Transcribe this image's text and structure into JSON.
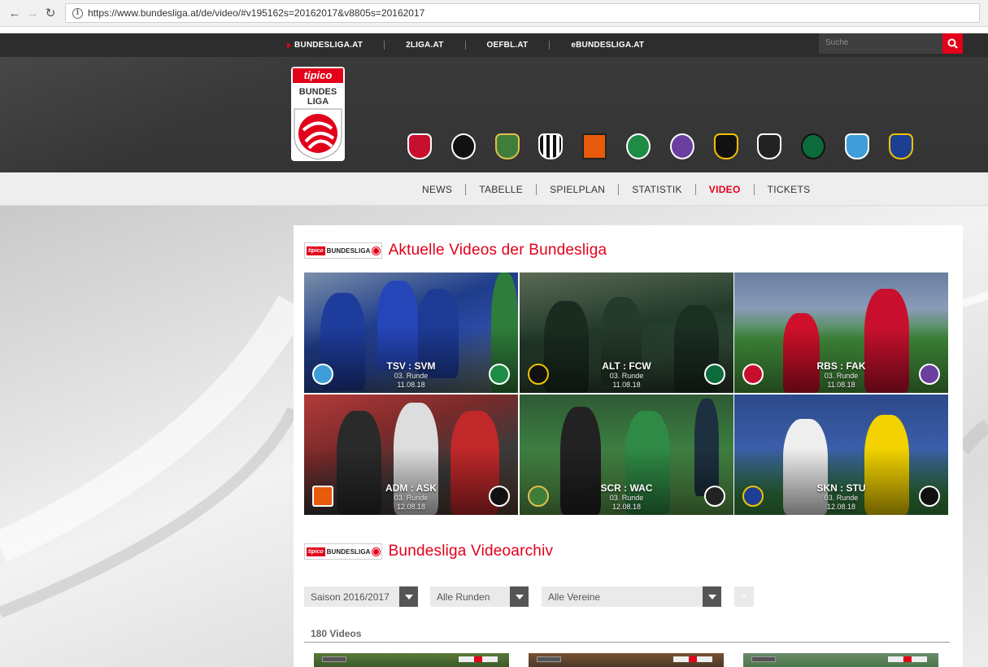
{
  "browser": {
    "url": "https://www.bundesliga.at/de/video/#v195162s=20162017&v8805s=20162017",
    "back_icon": "arrow-left-icon",
    "forward_icon": "arrow-right-icon",
    "reload_icon": "reload-icon"
  },
  "topnav": {
    "items": [
      "BUNDESLIGA.AT",
      "2LIGA.AT",
      "OEFBL.AT",
      "eBUNDESLIGA.AT"
    ],
    "search_placeholder": "Suche"
  },
  "logo": {
    "brand": "tipico",
    "line1": "BUNDES",
    "line2": "LIGA"
  },
  "clubs": [
    "Red Bull Salzburg",
    "Sturm Graz",
    "Rapid Wien",
    "LASK",
    "Admira",
    "Rapid",
    "Austria Wien",
    "SCR Altach",
    "WAC",
    "FC Wacker",
    "Hartberg",
    "St. Pölten"
  ],
  "mainnav": {
    "items": [
      "NEWS",
      "TABELLE",
      "SPIELPLAN",
      "STATISTIK",
      "VIDEO",
      "TICKETS"
    ],
    "active_index": 4
  },
  "colors": {
    "accent": "#e2001a",
    "dark_bar": "#2d2d2d"
  },
  "section1": {
    "logo_brand": "tipico",
    "logo_text": "BUNDESLIGA",
    "title": "Aktuelle Videos der Bundesliga"
  },
  "videos": [
    {
      "match": "TSV : SVM",
      "round": "03. Runde",
      "date": "11.08.18"
    },
    {
      "match": "ALT : FCW",
      "round": "03. Runde",
      "date": "11.08.18"
    },
    {
      "match": "RBS : FAK",
      "round": "03. Runde",
      "date": "11.08.18"
    },
    {
      "match": "ADM : ASK",
      "round": "03. Runde",
      "date": "12.08.18"
    },
    {
      "match": "SCR : WAC",
      "round": "03. Runde",
      "date": "12.08.18"
    },
    {
      "match": "SKN : STU",
      "round": "03. Runde",
      "date": "12.08.18"
    }
  ],
  "section2": {
    "logo_brand": "tipico",
    "logo_text": "BUNDESLIGA",
    "title": "Bundesliga Videoarchiv"
  },
  "filters": {
    "season": "Saison 2016/2017",
    "rounds": "Alle Runden",
    "clubs": "Alle Vereine",
    "clear": "×"
  },
  "archive": {
    "count": "180 Videos"
  }
}
